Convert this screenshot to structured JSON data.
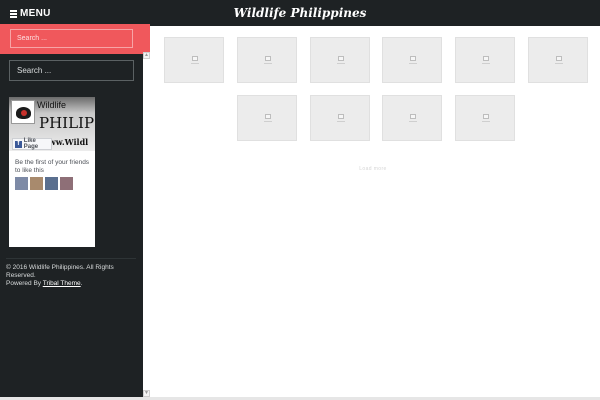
{
  "header": {
    "menu_label": "MENU",
    "site_title": "Wildlife Philippines"
  },
  "sidebar": {
    "search_top_placeholder": "Search ...",
    "search_side_placeholder": "Search ...",
    "fb_widget": {
      "page_name": "Wildlife",
      "cover_big_text": "PHILIP",
      "cover_url_text": "www.Wildl",
      "like_button": "Like Page",
      "friends_text": "Be the first of your friends to like this"
    }
  },
  "footer": {
    "copyright": "© 2016 Wildlife Philippines. All Rights Reserved.",
    "powered_prefix": "Powered By ",
    "theme_link": "Tribal Theme",
    "powered_suffix": "."
  },
  "main": {
    "load_more": "Load more"
  },
  "colors": {
    "topbar_bg": "#1e2224",
    "sidebar_bg": "#1e2224",
    "accent_red": "#f0585c",
    "placeholder_gray": "#ececec"
  }
}
